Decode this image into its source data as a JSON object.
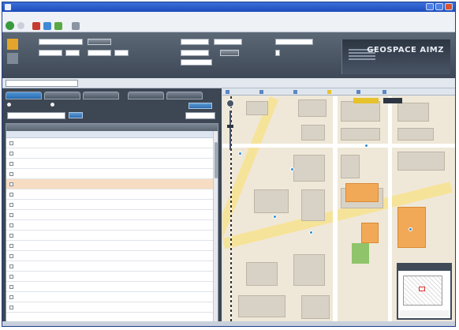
{
  "window": {
    "title": "",
    "accent": "#1d4dbb"
  },
  "menubar": {
    "items": []
  },
  "search": {
    "labels": [],
    "fields": [],
    "button_label": "",
    "checkbox_label": ""
  },
  "brand": {
    "title": "GEOSPACE AIMZ",
    "subtitle": ""
  },
  "layerbar": {
    "selected_layer": ""
  },
  "panel": {
    "tabs": [],
    "radio_options": [],
    "filter_value": "",
    "search_button": "",
    "export_button": "",
    "group_label": ""
  },
  "table": {
    "columns": [],
    "rows": [
      {
        "highlighted": false
      },
      {
        "highlighted": false
      },
      {
        "highlighted": false
      },
      {
        "highlighted": false
      },
      {
        "highlighted": true
      },
      {
        "highlighted": false
      },
      {
        "highlighted": false
      },
      {
        "highlighted": false
      },
      {
        "highlighted": false
      },
      {
        "highlighted": false
      },
      {
        "highlighted": false
      },
      {
        "highlighted": false
      },
      {
        "highlighted": false
      },
      {
        "highlighted": false
      },
      {
        "highlighted": false
      },
      {
        "highlighted": false
      },
      {
        "highlighted": false
      }
    ]
  },
  "map": {
    "toolbar_items": [],
    "minimap_title": "",
    "minimap_caption": "",
    "tags": []
  }
}
